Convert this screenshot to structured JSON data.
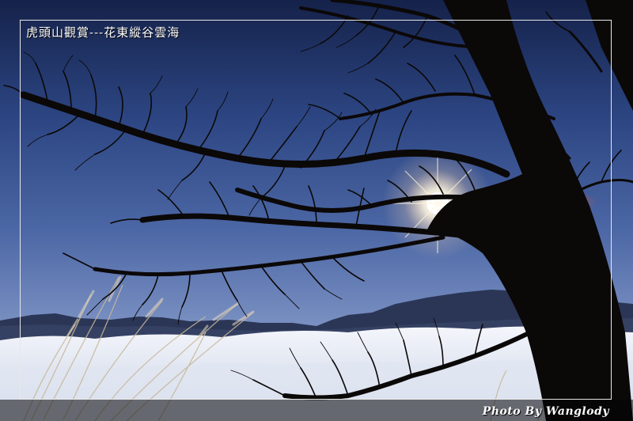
{
  "photo": {
    "title": "虎頭山觀賞---花東縱谷雲海",
    "credit": "Photo By Wanglody",
    "scene": "tree-silhouette-over-sea-of-clouds-icon",
    "colors": {
      "sky_top": "#1a2a56",
      "sky_mid": "#3a5596",
      "sky_bottom": "#6a86bd",
      "cloud": "#e9edf6",
      "sun": "#ffffff",
      "silhouette": "#0b0808"
    }
  }
}
